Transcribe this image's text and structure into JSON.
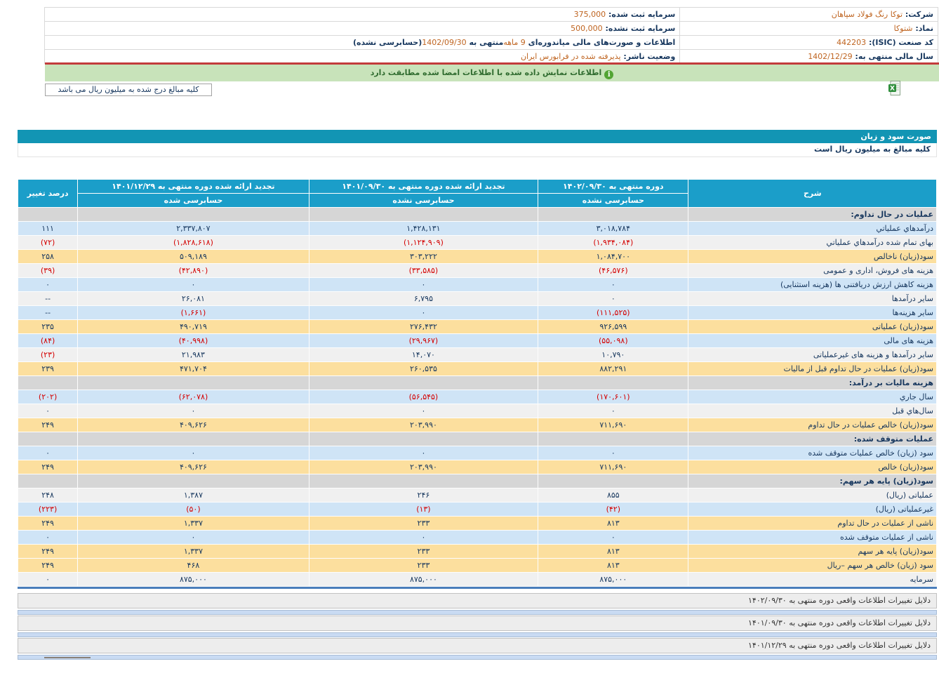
{
  "company_info": {
    "rows": [
      {
        "right": [
          {
            "k": "label",
            "t": "شرکت: "
          },
          {
            "k": "value",
            "t": "توکا رنگ فولاد سپاهان"
          }
        ],
        "left": [
          {
            "k": "label",
            "t": "سرمایه ثبت شده: "
          },
          {
            "k": "value",
            "t": "375,000"
          }
        ]
      },
      {
        "right": [
          {
            "k": "label",
            "t": "نماد: "
          },
          {
            "k": "value",
            "t": "شتوکا"
          }
        ],
        "left": [
          {
            "k": "label",
            "t": "سرمایه ثبت نشده: "
          },
          {
            "k": "value",
            "t": "500,000"
          }
        ]
      },
      {
        "right": [
          {
            "k": "label",
            "t": "کد صنعت (ISIC): "
          },
          {
            "k": "value",
            "t": "442203"
          }
        ],
        "left": [
          {
            "k": "label",
            "t": "اطلاعات و صورت‌های مالی میاندوره‌ای "
          },
          {
            "k": "value",
            "t": "9 ماهه"
          },
          {
            "k": "label",
            "t": "‌منتهی به "
          },
          {
            "k": "value",
            "t": "1402/09/30"
          },
          {
            "k": "label",
            "t": "(حسابرسی نشده)"
          }
        ]
      },
      {
        "right": [
          {
            "k": "label",
            "t": "سال مالی منتهی به: "
          },
          {
            "k": "value",
            "t": "1402/12/29"
          }
        ],
        "left": [
          {
            "k": "label",
            "t": "وضعیت ناشر: "
          },
          {
            "k": "value",
            "t": "پذیرفته شده در فرابورس ایران"
          }
        ]
      }
    ]
  },
  "banner": {
    "text": "اطلاعات نمایش داده شده با اطلاعات امضا شده مطابقت دارد",
    "icon": "info-icon"
  },
  "unit_box": {
    "text": "کلیه مبالغ درج شده به میلیون ریال می باشد"
  },
  "excel_icon_name": "excel-export-icon",
  "statement_bar": {
    "title": "صورت سود و زیان"
  },
  "unit_row": {
    "text": "کلیه مبالغ به میلیون ریال است"
  },
  "table": {
    "desc_header": "شرح",
    "pct_header": "درصد تغییر",
    "period_headers": [
      {
        "line1": "دوره منتهی به ۱۴۰۲/۰۹/۳۰",
        "line2": "حسابرسی نشده"
      },
      {
        "line1": "تجدید ارائه شده دوره منتهی به ۱۴۰۱/۰۹/۳۰",
        "line2": "حسابرسی نشده"
      },
      {
        "line1": "تجدید ارائه شده دوره منتهی به ۱۴۰۱/۱۲/۲۹",
        "line2": "حسابرسی شده"
      }
    ],
    "rows": [
      {
        "type": "section",
        "desc": "عملیات در حال تداوم:"
      },
      {
        "type": "data",
        "variant": "blue",
        "desc": "درآمدهاي عملياتي",
        "c1": "۳,۰۱۸,۷۸۴",
        "c2": "۱,۴۲۸,۱۳۱",
        "c3": "۲,۳۳۷,۸۰۷",
        "pct": "۱۱۱"
      },
      {
        "type": "data",
        "variant": "white",
        "desc": "بهای تمام شده درآمدهاي عملياتي",
        "c1": "(۱,۹۳۴,۰۸۴)",
        "c2": "(۱,۱۲۴,۹۰۹)",
        "c3": "(۱,۸۲۸,۶۱۸)",
        "pct": "(۷۲)"
      },
      {
        "type": "data",
        "variant": "yellow",
        "desc": "سود(زیان) ناخالص",
        "c1": "۱,۰۸۴,۷۰۰",
        "c2": "۳۰۳,۲۲۲",
        "c3": "۵۰۹,۱۸۹",
        "pct": "۲۵۸"
      },
      {
        "type": "data",
        "variant": "white",
        "desc": "هزینه های فروش، اداری و عمومی",
        "c1": "(۴۶,۵۷۶)",
        "c2": "(۳۳,۵۸۵)",
        "c3": "(۴۲,۸۹۰)",
        "pct": "(۳۹)"
      },
      {
        "type": "data",
        "variant": "blue",
        "desc": "هزینه کاهش ارزش دریافتنی ها (هزینه استثنایی)",
        "c1": "۰",
        "c2": "۰",
        "c3": "۰",
        "pct": "۰"
      },
      {
        "type": "data",
        "variant": "white",
        "desc": "سایر درآمدها",
        "c1": "۰",
        "c2": "۶,۷۹۵",
        "c3": "۲۶,۰۸۱",
        "pct": "--"
      },
      {
        "type": "data",
        "variant": "blue",
        "desc": "سایر هزینه‌ها",
        "c1": "(۱۱۱,۵۲۵)",
        "c2": "۰",
        "c3": "(۱,۶۶۱)",
        "pct": "--"
      },
      {
        "type": "data",
        "variant": "yellow",
        "desc": "سود(زیان) عملیاتی",
        "c1": "۹۲۶,۵۹۹",
        "c2": "۲۷۶,۴۳۲",
        "c3": "۴۹۰,۷۱۹",
        "pct": "۲۳۵"
      },
      {
        "type": "data",
        "variant": "blue",
        "desc": "هزینه های مالی",
        "c1": "(۵۵,۰۹۸)",
        "c2": "(۲۹,۹۶۷)",
        "c3": "(۴۰,۹۹۸)",
        "pct": "(۸۴)"
      },
      {
        "type": "data",
        "variant": "white",
        "desc": "سایر درآمدها و هزینه های غیرعملیاتی",
        "c1": "۱۰,۷۹۰",
        "c2": "۱۴,۰۷۰",
        "c3": "۲۱,۹۸۳",
        "pct": "(۲۳)"
      },
      {
        "type": "data",
        "variant": "yellow",
        "desc": "سود(زیان) عملیات در حال تداوم قبل از مالیات",
        "c1": "۸۸۲,۲۹۱",
        "c2": "۲۶۰,۵۳۵",
        "c3": "۴۷۱,۷۰۴",
        "pct": "۲۳۹"
      },
      {
        "type": "section",
        "desc": "هزینه مالیات بر درآمد:"
      },
      {
        "type": "data",
        "variant": "blue",
        "desc": "سال جاري",
        "c1": "(۱۷۰,۶۰۱)",
        "c2": "(۵۶,۵۴۵)",
        "c3": "(۶۲,۰۷۸)",
        "pct": "(۲۰۲)"
      },
      {
        "type": "data",
        "variant": "white",
        "desc": "سال‌هاي قبل",
        "c1": "۰",
        "c2": "۰",
        "c3": "۰",
        "pct": "۰"
      },
      {
        "type": "data",
        "variant": "yellow",
        "desc": "سود(زیان) خالص عملیات در حال تداوم",
        "c1": "۷۱۱,۶۹۰",
        "c2": "۲۰۳,۹۹۰",
        "c3": "۴۰۹,۶۲۶",
        "pct": "۲۴۹"
      },
      {
        "type": "section",
        "desc": "عملیات متوقف شده:"
      },
      {
        "type": "data",
        "variant": "blue",
        "desc": "سود (زیان) خالص عملیات متوقف شده",
        "c1": "۰",
        "c2": "۰",
        "c3": "۰",
        "pct": "۰"
      },
      {
        "type": "data",
        "variant": "yellow",
        "desc": "سود(زیان) خالص",
        "c1": "۷۱۱,۶۹۰",
        "c2": "۲۰۳,۹۹۰",
        "c3": "۴۰۹,۶۲۶",
        "pct": "۲۴۹"
      },
      {
        "type": "section",
        "desc": "سود(زیان) پایه هر سهم:"
      },
      {
        "type": "data",
        "variant": "white",
        "desc": "عملیاتی (ریال)",
        "c1": "۸۵۵",
        "c2": "۲۴۶",
        "c3": "۱,۳۸۷",
        "pct": "۲۴۸"
      },
      {
        "type": "data",
        "variant": "blue",
        "desc": "غیرعملیاتی (ریال)",
        "c1": "(۴۲)",
        "c2": "(۱۳)",
        "c3": "(۵۰)",
        "pct": "(۲۲۳)"
      },
      {
        "type": "data",
        "variant": "yellow",
        "desc": "ناشی از عملیات در حال تداوم",
        "c1": "۸۱۳",
        "c2": "۲۳۳",
        "c3": "۱,۳۳۷",
        "pct": "۲۴۹"
      },
      {
        "type": "data",
        "variant": "blue",
        "desc": "ناشی از عملیات متوقف شده",
        "c1": "۰",
        "c2": "۰",
        "c3": "۰",
        "pct": "۰"
      },
      {
        "type": "data",
        "variant": "yellow",
        "desc": "سود(زیان) پایه هر سهم",
        "c1": "۸۱۳",
        "c2": "۲۳۳",
        "c3": "۱,۳۳۷",
        "pct": "۲۴۹"
      },
      {
        "type": "data",
        "variant": "yellow",
        "desc": "سود (زیان) خالص هر سهم –ریال",
        "c1": "۸۱۳",
        "c2": "۲۳۳",
        "c3": "۴۶۸",
        "pct": "۲۴۹"
      },
      {
        "type": "data",
        "variant": "white",
        "desc": "سرمایه",
        "c1": "۸۷۵,۰۰۰",
        "c2": "۸۷۵,۰۰۰",
        "c3": "۸۷۵,۰۰۰",
        "pct": "۰"
      }
    ]
  },
  "footer_links": [
    "دلایل تغییرات اطلاعات واقعی دوره منتهی به ۱۴۰۲/۰۹/۳۰",
    "دلایل تغییرات اطلاعات واقعی دوره منتهی به ۱۴۰۱/۰۹/۳۰",
    "دلایل تغییرات اطلاعات واقعی دوره منتهی به ۱۴۰۱/۱۲/۲۹"
  ]
}
